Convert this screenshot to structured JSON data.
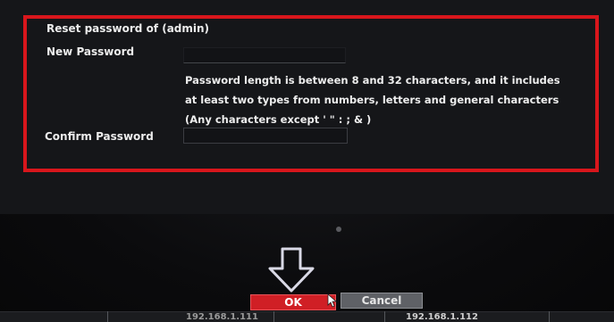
{
  "dialog": {
    "title": "Reset password of (admin)",
    "new_password_label": "New Password",
    "new_password_value": "",
    "hint_lines": [
      "Password length is between 8 and 32 characters, and it includes",
      "at least two types from numbers, letters and general characters",
      "(Any characters except  ' \" : ; & )"
    ],
    "confirm_password_label": "Confirm Password",
    "confirm_password_value": ""
  },
  "buttons": {
    "ok_label": "OK",
    "cancel_label": "Cancel"
  },
  "bottom_bar": {
    "ip_left": "192.168.1.111",
    "ip_right": "192.168.1.112"
  },
  "colors": {
    "highlight": "#d8161c",
    "ok_button": "#d01f25",
    "cancel_button": "#5f6166"
  },
  "icons": {
    "annotation_arrow": "arrow-down-icon",
    "mouse_cursor": "cursor-icon"
  }
}
